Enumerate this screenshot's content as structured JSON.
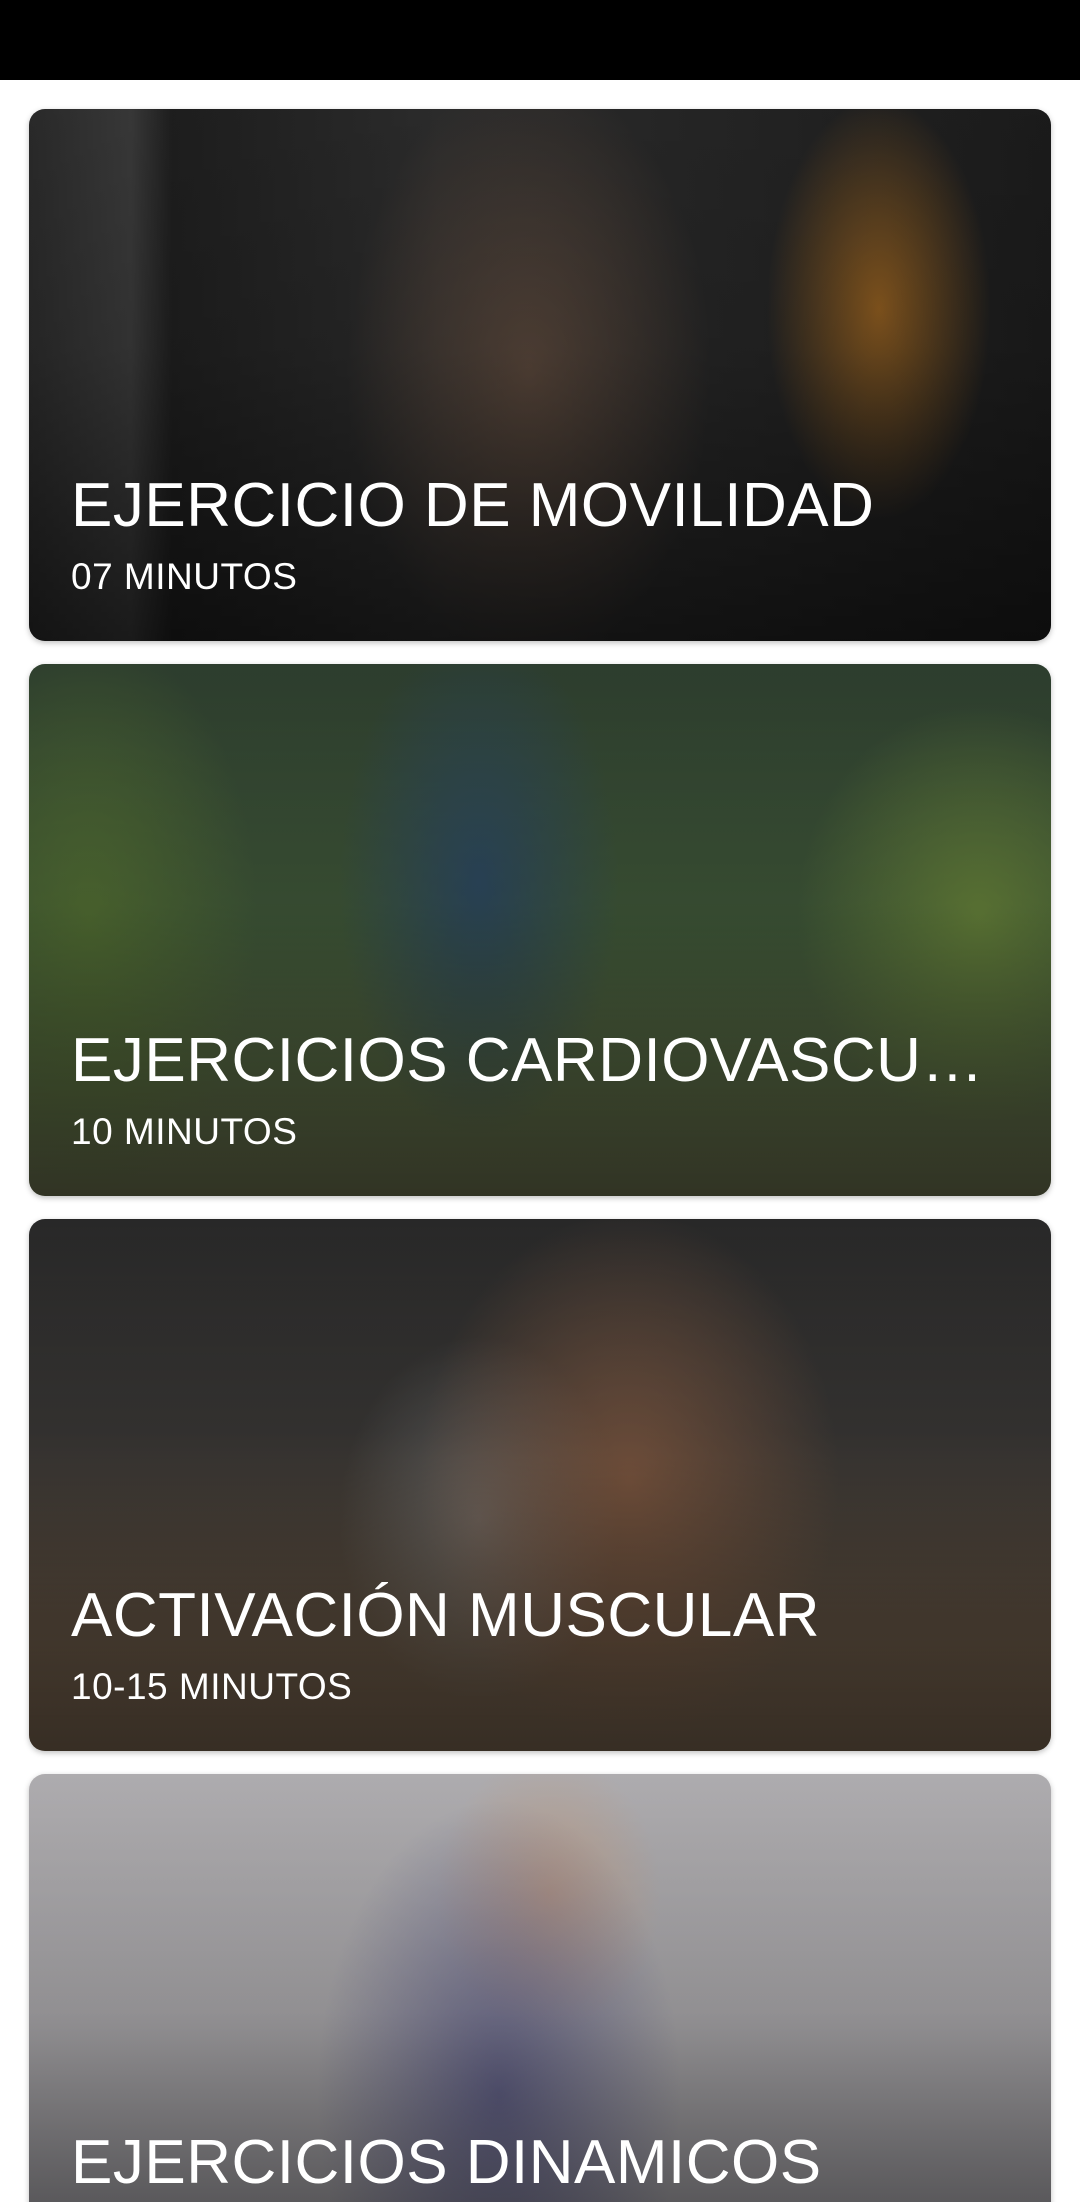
{
  "cards": [
    {
      "title": "EJERCICIO DE MOVILIDAD",
      "duration": "07 MINUTOS"
    },
    {
      "title": "EJERCICIOS CARDIOVASCU…",
      "duration": "10 MINUTOS"
    },
    {
      "title": "ACTIVACIÓN MUSCULAR",
      "duration": "10-15 MINUTOS"
    },
    {
      "title": "EJERCICIOS DINAMICOS",
      "duration": ""
    }
  ],
  "colors": {
    "status_bar": "#000000",
    "background": "#ffffff",
    "card_text": "#ffffff"
  }
}
